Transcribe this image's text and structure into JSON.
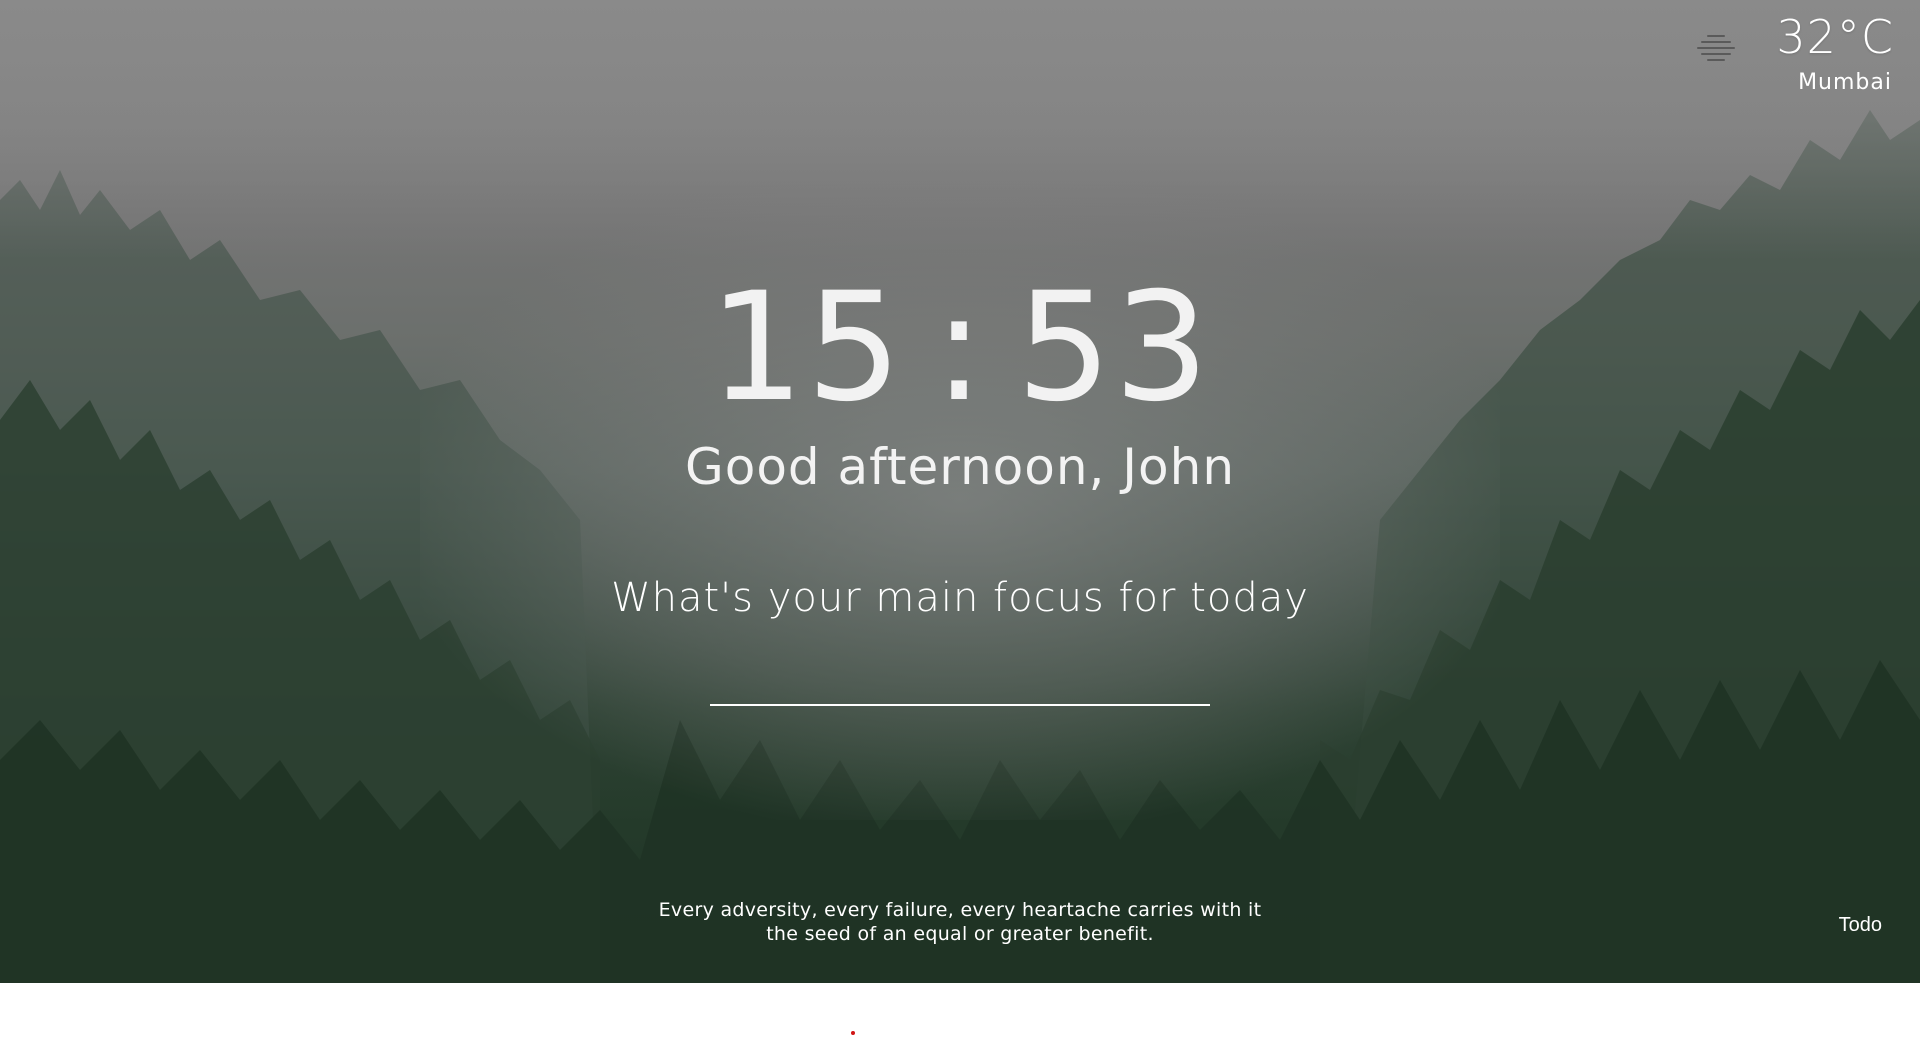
{
  "weather": {
    "icon": "fog-icon",
    "temperature": "32°C",
    "location": "Mumbai"
  },
  "clock": {
    "hours": "15",
    "separator": ":",
    "minutes": "53"
  },
  "greeting": "Good afternoon, John",
  "focus": {
    "prompt": "What's your main focus for today",
    "value": "",
    "placeholder": ""
  },
  "quote": "Every adversity, every failure, every heartache carries with it the seed of an equal or greater benefit.",
  "todo": {
    "label": "Todo"
  },
  "colors": {
    "text": "#ffffff",
    "underline": "#ffffff",
    "accent_dot": "#d01515"
  }
}
